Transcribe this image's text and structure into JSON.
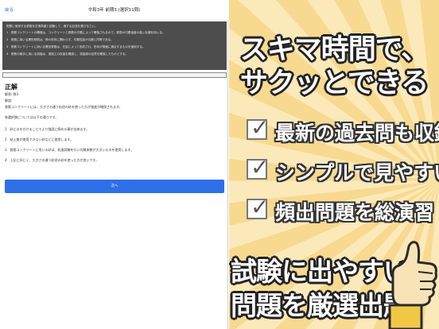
{
  "topbar": {
    "back_label": "戻る",
    "title": "令和3年 前期3 (選択11問)"
  },
  "question": {
    "stem": "配筋に使用する鉄筋を引張荷重と試験して、適する記述を選びなさい。",
    "options": [
      "1　鉄筋コンクリートの構造は、コンクリートと鉄筋の付着によって確保されるので、鉄筋の付着強度の高い丸鋼を用いる。",
      "2　鉄筋に用いる異形鉄筋は、節の形状に関わらず、付着性能が丸鋼と同等である。",
      "3　鉄筋コンクリートに用いる異形鉄筋は、圧延によって形成され、形状が規格に適合するものを使用する。",
      "4　鉄筋の継手に用いる溶接は、溶接工の技量を確認し、溶接部の品質を確保したものとする。"
    ]
  },
  "answer": {
    "heading": "正解",
    "answer_line": "解答: 肢3",
    "explanation_label": "解説:",
    "explanation": "鉄筋コンクリートには、大きさの違う粒径の砂を使った方が強度が確保されます。",
    "others_intro": "各選択肢については以下の通りです。",
    "points": [
      "1　砂に水をかけることでより強固に締める事が出来ます。",
      "2　粘土質が使用できない砂などに使用します。",
      "3　鉄筋コンクリートに用いる砂は、粒度試験を行い均質係数が大きいものを使用します。",
      "4　上記と同じく、大きさの違う粒径の砂を使った方が良いです。"
    ]
  },
  "next_button": {
    "label": "次へ"
  },
  "promo": {
    "headline_line1": "スキマ時間で、",
    "headline_line2": "サクッとできる",
    "features": [
      {
        "check": "✓",
        "text": "最新の過去問も収録"
      },
      {
        "check": "✓",
        "text": "シンプルで見やすい"
      },
      {
        "check": "✓",
        "text": "頻出問題を総演習"
      }
    ],
    "bottom_line1": "試験に出やすい",
    "bottom_line2": "問題を厳選出題",
    "colors": {
      "bg_light": "#fbe9b9",
      "bg_dark": "#f7d990",
      "button_blue": "#2f6fe8",
      "panel_dark": "#4d4d4d"
    },
    "illustration_icon": "thumbs-up-hand-icon"
  }
}
